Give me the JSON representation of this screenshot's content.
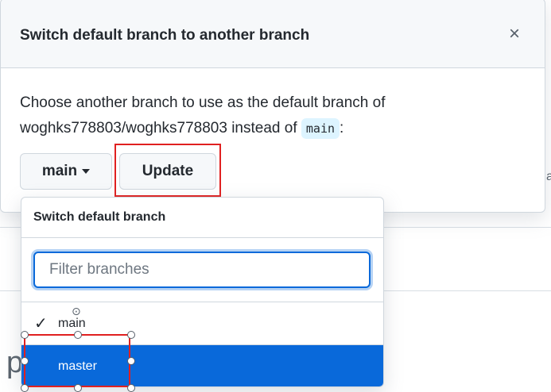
{
  "dialog": {
    "title": "Switch default branch to another branch",
    "close_symbol": "×",
    "description_line1": "Choose another branch to use as the default branch of",
    "description_line2": "woghks778803/woghks778803 instead of",
    "current_branch_code": "main",
    "description_suffix": ":",
    "branch_button_label": "main",
    "update_button_label": "Update"
  },
  "dropdown": {
    "header": "Switch default branch",
    "filter_placeholder": "Filter branches",
    "items": [
      {
        "label": "main",
        "checked": true,
        "check_symbol": "✓"
      },
      {
        "label": "master",
        "checked": false
      }
    ]
  },
  "background": {
    "edge_char": "a",
    "big_char": "p"
  },
  "colors": {
    "accent": "#0969da",
    "highlight_outline": "#e02020",
    "code_bg": "#ddf4ff"
  },
  "icons": {
    "close": "close-icon",
    "caret": "caret-down-icon",
    "check": "check-icon"
  }
}
